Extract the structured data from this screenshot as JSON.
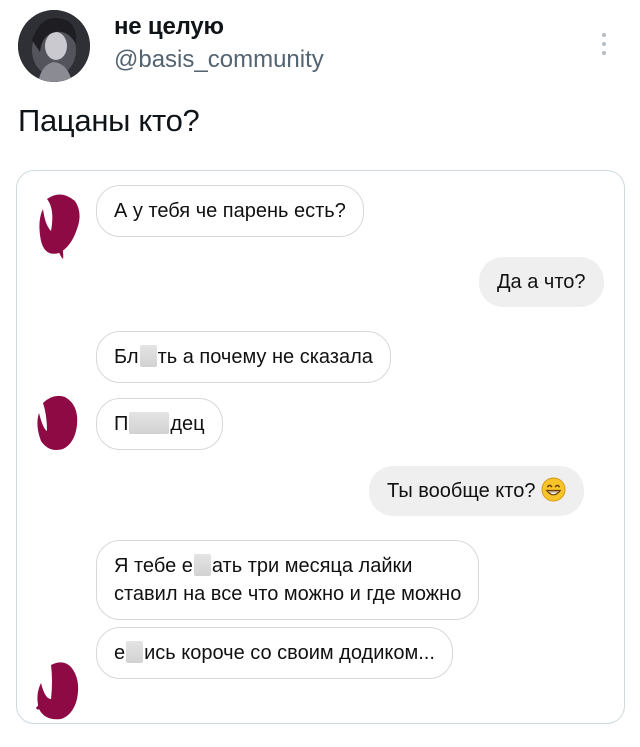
{
  "post": {
    "author_name": "не целую",
    "author_handle": "@basis_community",
    "text": "Пацаны кто?"
  },
  "chat": {
    "messages": [
      {
        "side": "in",
        "text": "А у тебя че парень есть?"
      },
      {
        "side": "out",
        "text": "Да а что?"
      },
      {
        "side": "in",
        "parts": [
          "Бл",
          "ть а почему не сказала"
        ]
      },
      {
        "side": "in",
        "parts": [
          "П",
          "дец"
        ]
      },
      {
        "side": "out",
        "text": "Ты вообще кто?",
        "emoji": "grinning-face-emoji"
      },
      {
        "side": "in",
        "line1_parts": [
          "Я тебе е",
          "ать три месяца лайки"
        ],
        "line2": "ставил на все что можно и где можно"
      },
      {
        "side": "in",
        "parts": [
          "е",
          "ись короче со своим додиком..."
        ]
      }
    ]
  },
  "colors": {
    "scribble": "#8e0a45",
    "handle": "#536471",
    "outgoing_bubble": "#efefef",
    "incoming_border": "#d8d8da"
  }
}
